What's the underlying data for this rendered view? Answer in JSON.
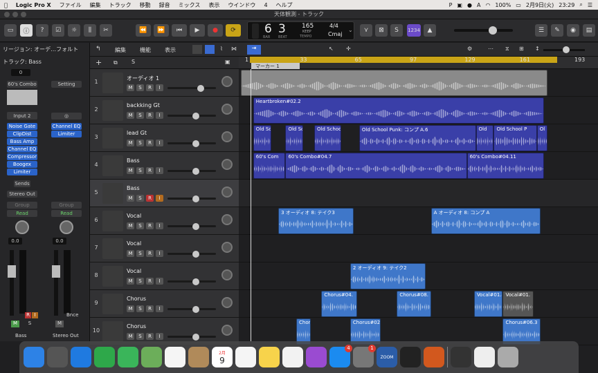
{
  "menubar": {
    "apple": "",
    "app": "Logic Pro X",
    "items": [
      "ファイル",
      "編集",
      "トラック",
      "移動",
      "録音",
      "ミックス",
      "表示",
      "ウインドウ",
      "4",
      "ヘルプ"
    ],
    "status": {
      "battery": "100%",
      "date": "2月9日(火)",
      "time": "23:29"
    }
  },
  "window": {
    "title": "天体観測 - トラック"
  },
  "transport": {
    "bar": "6",
    "beat": "3",
    "bar_label": "BAR",
    "beat_label": "BEAT",
    "tempo": "165",
    "tempo_mode": "KEEP",
    "tempo_label": "TEMPO",
    "signature": "4/4",
    "key": "Cmaj",
    "count_in": "1234"
  },
  "inspector": {
    "region_header": "リージョン: オーデ…フォルト",
    "track_header": "トラック: Bass",
    "strip1": {
      "value": "0",
      "setting": "60's Combo",
      "input": "Input 2",
      "plugins": [
        "Noise Gate",
        "ClipDist",
        "Bass Amp",
        "Channel EQ",
        "Compressor",
        "Boogex",
        "Limiter"
      ],
      "sends": "Sends",
      "output": "Stereo Out",
      "group": "Group",
      "automation": "Read",
      "volume": "0.0",
      "name": "Bass"
    },
    "strip2": {
      "setting": "Setting",
      "plugins": [
        "Channel EQ",
        "Limiter"
      ],
      "group": "Group",
      "automation": "Read",
      "volume": "0.0",
      "bnce": "Bnce",
      "name": "Stereo Out"
    }
  },
  "trackheader": {
    "menus": [
      "編集",
      "機能",
      "表示"
    ],
    "add": "+",
    "s": "S"
  },
  "tracks": [
    {
      "num": "1",
      "name": "オーディオ 1",
      "vol": 0.72
    },
    {
      "num": "2",
      "name": "backking Gt",
      "vol": 0.6
    },
    {
      "num": "3",
      "name": "lead Gt",
      "vol": 0.6
    },
    {
      "num": "4",
      "name": "Bass",
      "vol": 0.6
    },
    {
      "num": "5",
      "name": "Bass",
      "vol": 0.6
    },
    {
      "num": "6",
      "name": "Vocal",
      "vol": 0.6
    },
    {
      "num": "7",
      "name": "Vocal",
      "vol": 0.6
    },
    {
      "num": "8",
      "name": "Vocal",
      "vol": 0.6
    },
    {
      "num": "9",
      "name": "Chorus",
      "vol": 0.6
    },
    {
      "num": "10",
      "name": "Chorus",
      "vol": 0.6
    }
  ],
  "buttons": {
    "m": "M",
    "s": "S",
    "r": "R",
    "i": "I"
  },
  "ruler": {
    "marks": [
      "1",
      "33",
      "65",
      "97",
      "129",
      "161",
      "193"
    ],
    "marker": "マーカー 1"
  },
  "regions": [
    {
      "track": 0,
      "label": "",
      "start": 0.005,
      "end": 0.86,
      "color": "#8a8a8a"
    },
    {
      "track": 1,
      "label": "Heartbroken#02.2",
      "start": 0.04,
      "end": 0.85,
      "color": "#3a3fa8"
    },
    {
      "track": 2,
      "label": "Old School P",
      "start": 0.04,
      "end": 0.09,
      "color": "#3a3fa8"
    },
    {
      "track": 2,
      "label": "Old School",
      "start": 0.13,
      "end": 0.18,
      "color": "#3a3fa8"
    },
    {
      "track": 2,
      "label": "Old School P",
      "start": 0.21,
      "end": 0.285,
      "color": "#3a3fa8"
    },
    {
      "track": 2,
      "label": "Old School Punk: コンプ A.6",
      "start": 0.335,
      "end": 0.66,
      "color": "#3a3fa8"
    },
    {
      "track": 2,
      "label": "Old",
      "start": 0.66,
      "end": 0.71,
      "color": "#3a3fa8"
    },
    {
      "track": 2,
      "label": "Old School P",
      "start": 0.71,
      "end": 0.83,
      "color": "#3a3fa8"
    },
    {
      "track": 2,
      "label": "Ol",
      "start": 0.83,
      "end": 0.86,
      "color": "#3a3fa8"
    },
    {
      "track": 3,
      "label": "60's Com",
      "start": 0.04,
      "end": 0.13,
      "color": "#3a3fa8"
    },
    {
      "track": 3,
      "label": "60's Combo#04.7",
      "start": 0.13,
      "end": 0.635,
      "color": "#3a3fa8"
    },
    {
      "track": 3,
      "label": "60's Combo#04.11",
      "start": 0.635,
      "end": 0.85,
      "color": "#3a3fa8"
    },
    {
      "track": 5,
      "label": "3 オーディオ 8: テイク3",
      "start": 0.11,
      "end": 0.32,
      "color": "#3f77c9"
    },
    {
      "track": 5,
      "label": "A オーディオ 8: コンプ A",
      "start": 0.535,
      "end": 0.84,
      "color": "#3f77c9"
    },
    {
      "track": 7,
      "label": "2 オーディオ 9: テイク2",
      "start": 0.31,
      "end": 0.52,
      "color": "#3f77c9"
    },
    {
      "track": 8,
      "label": "Chorus#04.",
      "start": 0.23,
      "end": 0.33,
      "color": "#3f77c9"
    },
    {
      "track": 8,
      "label": "Chorus#08.",
      "start": 0.44,
      "end": 0.535,
      "color": "#3f77c9"
    },
    {
      "track": 8,
      "label": "Vocal#01.4",
      "start": 0.655,
      "end": 0.735,
      "color": "#3f77c9"
    },
    {
      "track": 8,
      "label": "Vocal#01.",
      "start": 0.735,
      "end": 0.82,
      "color": "#555"
    },
    {
      "track": 9,
      "label": "Chor",
      "start": 0.16,
      "end": 0.2,
      "color": "#3f77c9"
    },
    {
      "track": 9,
      "label": "Chorus#02",
      "start": 0.31,
      "end": 0.395,
      "color": "#3f77c9"
    },
    {
      "track": 9,
      "label": "Chorus#06.3",
      "start": 0.735,
      "end": 0.84,
      "color": "#3f77c9"
    }
  ],
  "dock": {
    "apps": [
      {
        "icon": "finder-icon",
        "color": "#2d82e6"
      },
      {
        "icon": "launchpad-icon",
        "color": "#555"
      },
      {
        "icon": "safari-icon",
        "color": "#1f7ae0"
      },
      {
        "icon": "facetime-icon",
        "color": "#2ea84a"
      },
      {
        "icon": "messages-icon",
        "color": "#3ab55a"
      },
      {
        "icon": "maps-icon",
        "color": "#6cae5a"
      },
      {
        "icon": "photos-icon",
        "color": "#f5f5f5"
      },
      {
        "icon": "contacts-icon",
        "color": "#b08a5a"
      },
      {
        "icon": "calendar-icon",
        "color": "#ffffff"
      },
      {
        "icon": "reminders-icon",
        "color": "#f5f5f5"
      },
      {
        "icon": "notes-icon",
        "color": "#f7d34b"
      },
      {
        "icon": "music-icon",
        "color": "#f2f2f2"
      },
      {
        "icon": "podcasts-icon",
        "color": "#9a4bd1"
      },
      {
        "icon": "appstore-icon",
        "color": "#1b8bf0"
      },
      {
        "icon": "sysprefs-icon",
        "color": "#777"
      },
      {
        "icon": "zoom-icon",
        "color": "#2b5da8"
      },
      {
        "icon": "logic-icon",
        "color": "#222"
      },
      {
        "icon": "xcross-icon",
        "color": "#d2581e"
      },
      {
        "icon": "screenshot-icon",
        "color": "#333"
      },
      {
        "icon": "document-icon",
        "color": "#eee"
      },
      {
        "icon": "trash-icon",
        "color": "#aaa"
      }
    ],
    "calendar_month": "2月",
    "calendar_day": "9",
    "appstore_badge": "4",
    "sysprefs_badge": "1",
    "zoom_label": "ZOOM"
  }
}
